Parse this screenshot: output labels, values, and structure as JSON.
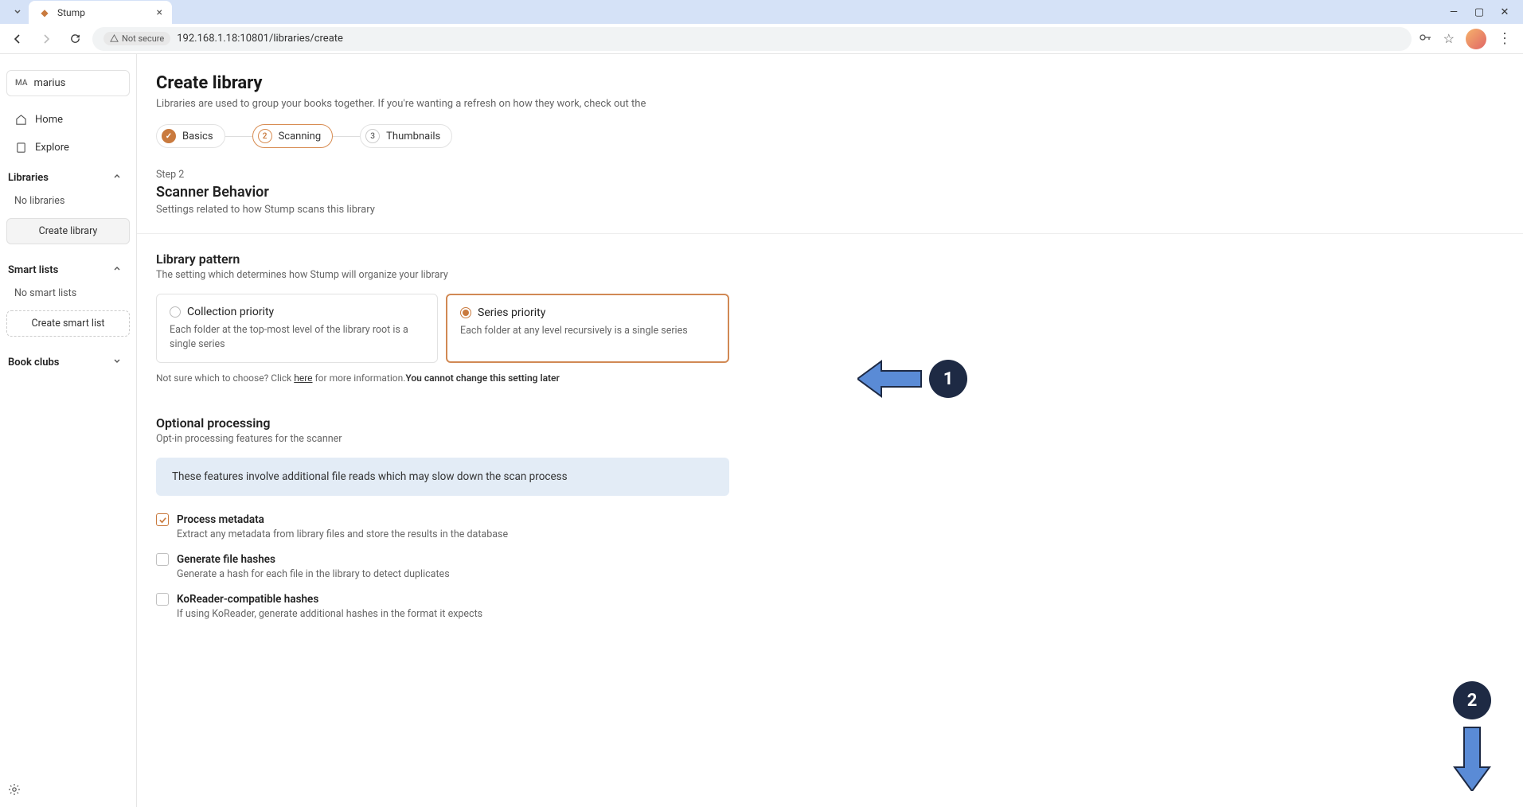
{
  "browser": {
    "tab_title": "Stump",
    "not_secure_label": "Not secure",
    "url": "192.168.1.18:10801/libraries/create"
  },
  "sidebar": {
    "user_initials": "MA",
    "user_name": "marius",
    "nav": {
      "home": "Home",
      "explore": "Explore"
    },
    "libraries": {
      "header": "Libraries",
      "empty": "No libraries",
      "create": "Create library"
    },
    "smartlists": {
      "header": "Smart lists",
      "empty": "No smart lists",
      "create": "Create smart list"
    },
    "bookclubs": {
      "header": "Book clubs"
    }
  },
  "page": {
    "title": "Create library",
    "subtitle": "Libraries are used to group your books together. If you're wanting a refresh on how they work, check out the"
  },
  "steps": {
    "s1": "Basics",
    "s2": "Scanning",
    "s3": "Thumbnails"
  },
  "scanner": {
    "step_label": "Step 2",
    "title": "Scanner Behavior",
    "desc": "Settings related to how Stump scans this library"
  },
  "pattern": {
    "title": "Library pattern",
    "desc": "The setting which determines how Stump will organize your library",
    "collection": {
      "title": "Collection priority",
      "desc": "Each folder at the top-most level of the library root is a single series"
    },
    "series": {
      "title": "Series priority",
      "desc": "Each folder at any level recursively is a single series"
    },
    "help_prefix": "Not sure which to choose? Click ",
    "help_link": "here",
    "help_middle": " for more information.",
    "help_bold": "You cannot change this setting later"
  },
  "optional": {
    "title": "Optional processing",
    "desc": "Opt-in processing features for the scanner",
    "banner": "These features involve additional file reads which may slow down the scan process",
    "process_metadata": {
      "label": "Process metadata",
      "desc": "Extract any metadata from library files and store the results in the database"
    },
    "file_hashes": {
      "label": "Generate file hashes",
      "desc": "Generate a hash for each file in the library to detect duplicates"
    },
    "koreader": {
      "label": "KoReader-compatible hashes",
      "desc": "If using KoReader, generate additional hashes in the format it expects"
    }
  },
  "annotations": {
    "a1": "1",
    "a2": "2"
  }
}
